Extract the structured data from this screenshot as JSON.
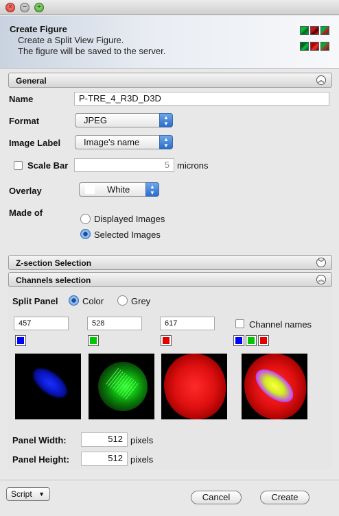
{
  "window": {
    "title": ""
  },
  "header": {
    "title": "Create Figure",
    "line1": "Create a Split View Figure.",
    "line2": "The figure will be saved to the server.",
    "icon": "split-view-figure-icon"
  },
  "general": {
    "section_label": "General",
    "name_label": "Name",
    "name_value": "P-TRE_4_R3D_D3D",
    "format_label": "Format",
    "format_value": "JPEG",
    "image_label_label": "Image Label",
    "image_label_value": "Image's name",
    "scale_bar_label": "Scale Bar",
    "scale_bar_checked": false,
    "scale_bar_value": "5",
    "scale_bar_unit": "microns",
    "overlay_label": "Overlay",
    "overlay_value": "White",
    "made_of_label": "Made of",
    "made_of_options": [
      "Displayed Images",
      "Selected Images"
    ],
    "made_of_selected": "Selected Images"
  },
  "zsection": {
    "section_label": "Z-section Selection"
  },
  "channels": {
    "section_label": "Channels selection",
    "split_panel_label": "Split Panel",
    "color_option": "Color",
    "grey_option": "Grey",
    "split_selected": "Color",
    "channel_names_label": "Channel names",
    "channel_names_checked": false,
    "items": [
      {
        "wavelength": "457",
        "color": "#0000ff"
      },
      {
        "wavelength": "528",
        "color": "#00c800"
      },
      {
        "wavelength": "617",
        "color": "#e00000"
      }
    ],
    "merged_colors": [
      "#0000ff",
      "#00c800",
      "#e00000"
    ]
  },
  "panel": {
    "width_label": "Panel Width:",
    "width_value": "512",
    "height_label": "Panel Height:",
    "height_value": "512",
    "unit": "pixels"
  },
  "footer": {
    "script_label": "Script",
    "cancel_label": "Cancel",
    "create_label": "Create"
  }
}
